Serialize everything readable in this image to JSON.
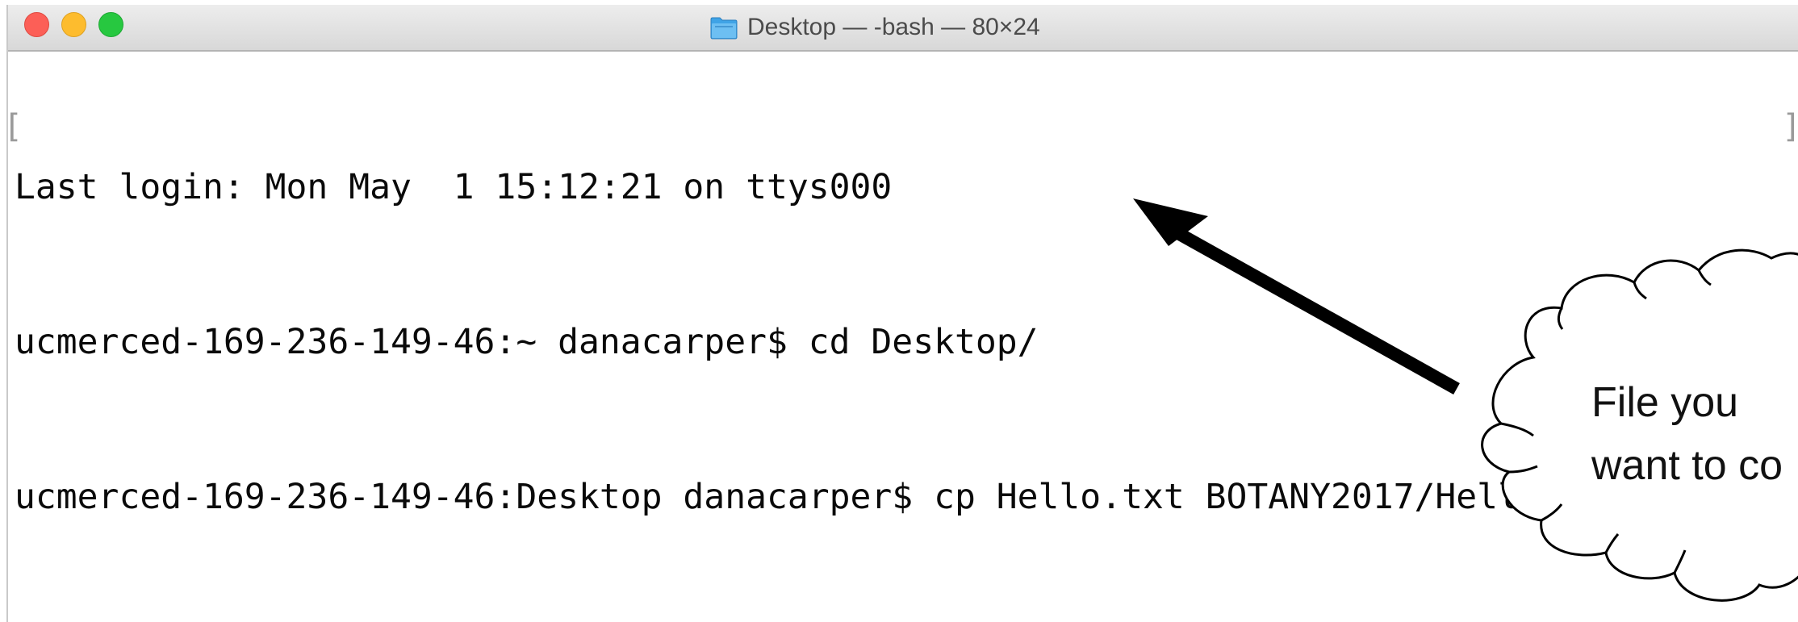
{
  "window": {
    "title": "Desktop — -bash — 80×24",
    "icon": "folder-icon"
  },
  "terminal": {
    "lines": [
      "Last login: Mon May  1 15:12:21 on ttys000",
      "ucmerced-169-236-149-46:~ danacarper$ cd Desktop/",
      "ucmerced-169-236-149-46:Desktop danacarper$ cp Hello.txt BOTANY2017/Hello.txt"
    ]
  },
  "annotation": {
    "line1": "File you",
    "line2": "want to co"
  },
  "colors": {
    "close": "#fc5f57",
    "minimize": "#fdbc2e",
    "zoom": "#27c840",
    "cursor": "#8a8a8a",
    "arrow": "#000000"
  }
}
